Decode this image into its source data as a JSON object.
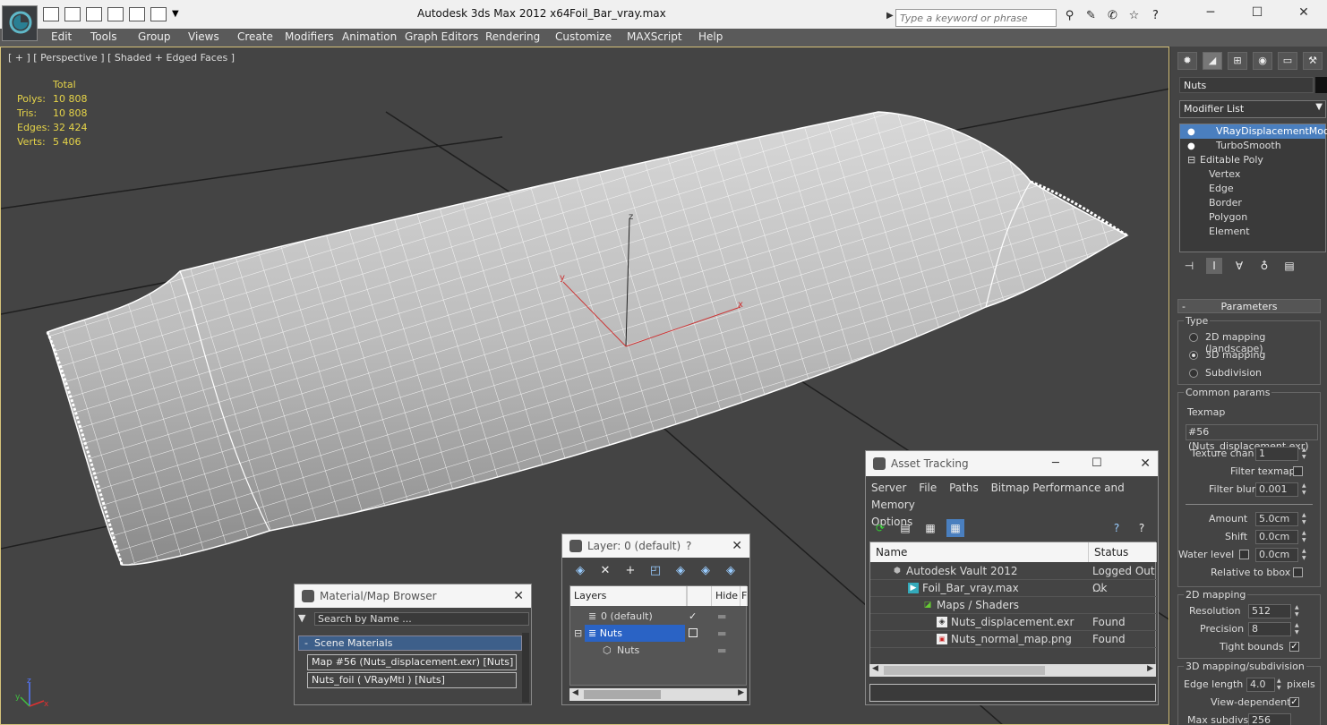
{
  "window": {
    "app_title": "Autodesk 3ds Max  2012 x64",
    "file_title": "Foil_Bar_vray.max",
    "search_placeholder": "Type a keyword or phrase",
    "minimize": "─",
    "maximize": "☐",
    "close": "✕"
  },
  "menu": [
    "Edit",
    "Tools",
    "Group",
    "Views",
    "Create",
    "Modifiers",
    "Animation",
    "Graph Editors",
    "Rendering",
    "Customize",
    "MAXScript",
    "Help"
  ],
  "viewport": {
    "label": "[ + ] [ Perspective ] [ Shaded + Edged Faces ]",
    "stats_header": "Total",
    "stats": [
      {
        "key": "Polys:",
        "value": "10 808"
      },
      {
        "key": "Tris:",
        "value": "10 808"
      },
      {
        "key": "Edges:",
        "value": "32 424"
      },
      {
        "key": "Verts:",
        "value": "5 406"
      }
    ],
    "gizmo": {
      "z": "z",
      "y": "y",
      "x": "x"
    },
    "axis_tripod": {
      "z": "z",
      "y": "y",
      "x": "x"
    }
  },
  "command_panel": {
    "object_name": "Nuts",
    "modifier_list": "Modifier List",
    "stack": [
      {
        "label": "VRayDisplacementMod",
        "selected": true,
        "bulb": true
      },
      {
        "label": "TurboSmooth",
        "selected": false,
        "bulb": true
      },
      {
        "label": "Editable Poly",
        "selected": false,
        "bulb": false,
        "expand": "⊟"
      },
      {
        "label": "Vertex",
        "sub": true
      },
      {
        "label": "Edge",
        "sub": true
      },
      {
        "label": "Border",
        "sub": true
      },
      {
        "label": "Polygon",
        "sub": true
      },
      {
        "label": "Element",
        "sub": true
      }
    ],
    "parameters": {
      "rollout_title": "Parameters",
      "type_title": "Type",
      "type_options": [
        "2D mapping (landscape)",
        "3D mapping",
        "Subdivision"
      ],
      "type_selected": "3D mapping",
      "common_title": "Common params",
      "texmap_label": "Texmap",
      "texmap_value": "#56 (Nuts_displacement.exr)",
      "texture_chan_label": "Texture chan",
      "texture_chan_value": "1",
      "filter_texmap_label": "Filter texmap",
      "filter_blur_label": "Filter blur",
      "filter_blur_value": "0.001",
      "amount_label": "Amount",
      "amount_value": "5.0cm",
      "shift_label": "Shift",
      "shift_value": "0.0cm",
      "water_level_label": "Water level",
      "water_level_value": "0.0cm",
      "relative_bbox_label": "Relative to bbox",
      "mapping2d_title": "2D mapping",
      "resolution_label": "Resolution",
      "resolution_value": "512",
      "precision_label": "Precision",
      "precision_value": "8",
      "tight_bounds_label": "Tight bounds",
      "mapping3d_title": "3D mapping/subdivision",
      "edge_length_label": "Edge length",
      "edge_length_value": "4.0",
      "pixels_label": "pixels",
      "view_dependent_label": "View-dependent",
      "max_subdivs_label": "Max subdivs",
      "max_subdivs_value": "256"
    }
  },
  "material_browser": {
    "title": "Material/Map Browser",
    "search_placeholder": "Search by Name ...",
    "section": "Scene Materials",
    "section_toggle": "-",
    "items": [
      "Map #56 (Nuts_displacement.exr)  [Nuts]",
      "Nuts_foil  ( VRayMtl )  [Nuts]"
    ]
  },
  "layer_window": {
    "title": "Layer: 0 (default)",
    "help": "?",
    "columns": [
      "Layers",
      "Hide",
      "F"
    ],
    "rows": [
      {
        "name": "0 (default)",
        "check": "✓",
        "indent": 1
      },
      {
        "name": "Nuts",
        "selected": true,
        "indent": 1,
        "expand": "⊟"
      },
      {
        "name": "Nuts",
        "indent": 2
      }
    ]
  },
  "asset_tracking": {
    "title": "Asset Tracking",
    "menu": [
      "Server",
      "File",
      "Paths",
      "Bitmap Performance and Memory",
      "Options"
    ],
    "columns": [
      "Name",
      "Status"
    ],
    "rows": [
      {
        "name": "Autodesk Vault 2012",
        "status": "Logged Out ...",
        "indent": 0,
        "icon": "vault-icon"
      },
      {
        "name": "Foil_Bar_vray.max",
        "status": "Ok",
        "indent": 1,
        "icon": "max-file-icon"
      },
      {
        "name": "Maps / Shaders",
        "status": "",
        "indent": 2,
        "icon": "maps-folder-icon"
      },
      {
        "name": "Nuts_displacement.exr",
        "status": "Found",
        "indent": 3,
        "icon": "exr-file-icon"
      },
      {
        "name": "Nuts_normal_map.png",
        "status": "Found",
        "indent": 3,
        "icon": "png-file-icon"
      }
    ]
  },
  "colors": {
    "viewport_bg": "#444444",
    "stats_text": "#e6d448",
    "selection": "#4a7fbf",
    "layer_selection": "#2a63c5"
  }
}
